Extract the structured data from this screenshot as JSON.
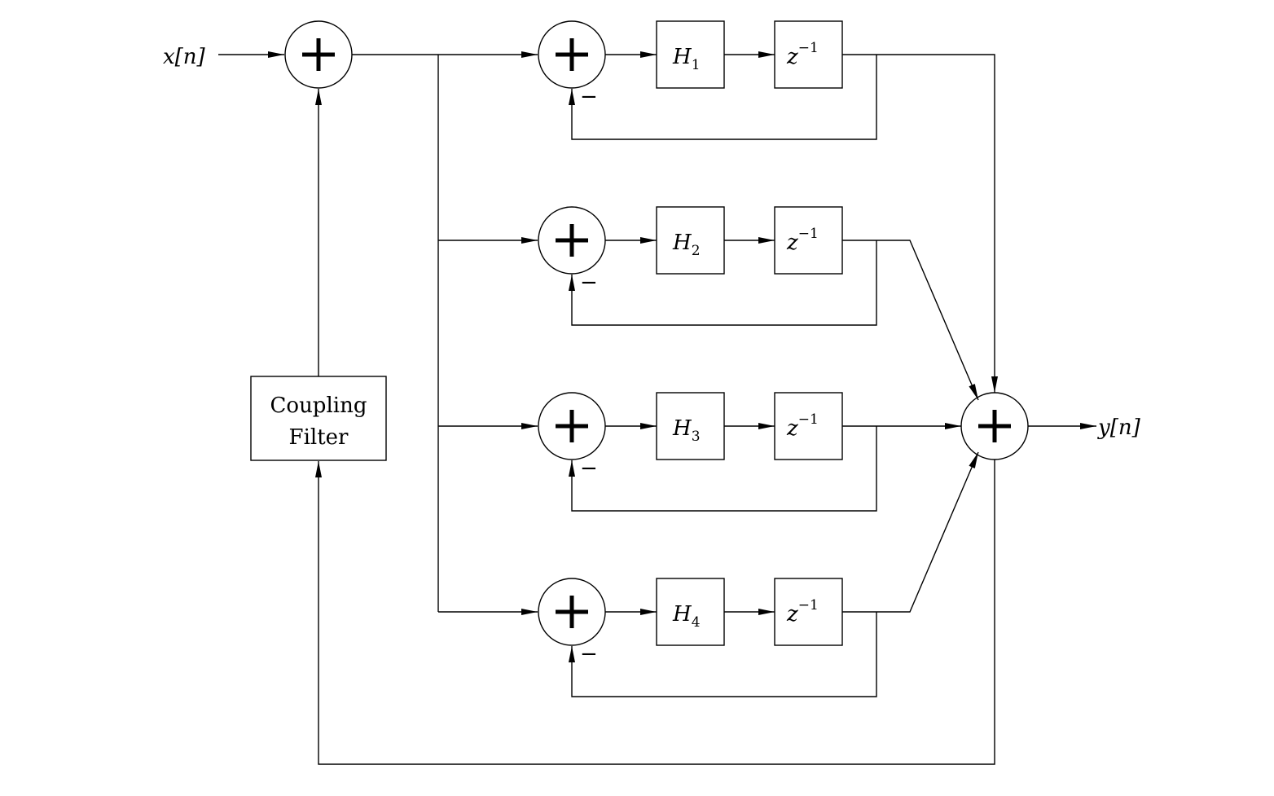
{
  "input_label": "x[n]",
  "output_label": "y[n]",
  "coupling_filter": {
    "line1": "Coupling",
    "line2": "Filter"
  },
  "minus_sign": "−",
  "delay": {
    "base": "z",
    "exp": "−1"
  },
  "branches": [
    {
      "filter": "H",
      "index": "1"
    },
    {
      "filter": "H",
      "index": "2"
    },
    {
      "filter": "H",
      "index": "3"
    },
    {
      "filter": "H",
      "index": "4"
    }
  ]
}
